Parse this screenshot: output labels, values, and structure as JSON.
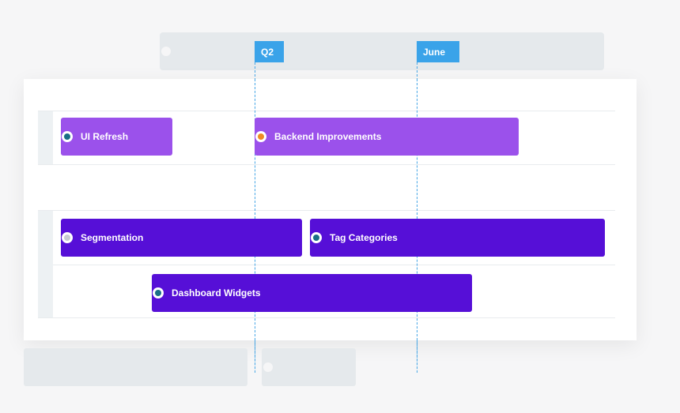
{
  "timeline": {
    "markers": [
      {
        "label": "Q2",
        "color": "#3aa3e9"
      },
      {
        "label": "June",
        "color": "#3aa3e9"
      }
    ]
  },
  "roadmap": {
    "bars": [
      {
        "label": "UI Refresh",
        "color": "#9b51eb",
        "dot_color": "#1a6e86"
      },
      {
        "label": "Backend Improvements",
        "color": "#9b51eb",
        "dot_color": "#f08a24"
      },
      {
        "label": "Segmentation",
        "color": "#560fd7",
        "dot_color": "#c8ccd4"
      },
      {
        "label": "Tag Categories",
        "color": "#560fd7",
        "dot_color": "#1a6e86"
      },
      {
        "label": "Dashboard Widgets",
        "color": "#560fd7",
        "dot_color": "#1a6e86"
      }
    ]
  }
}
